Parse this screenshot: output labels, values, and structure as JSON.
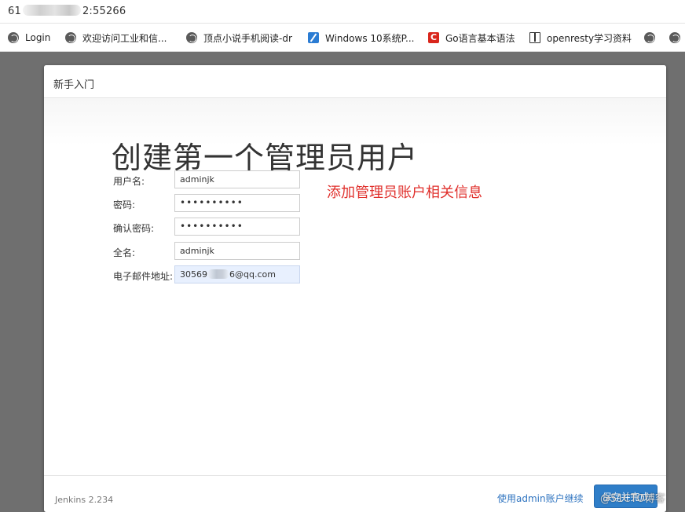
{
  "address_bar": {
    "url_prefix": "61",
    "url_suffix": "2:55266"
  },
  "bookmarks": [
    {
      "label": "Login",
      "icon": "globe-icon"
    },
    {
      "label": "欢迎访问工业和信...",
      "icon": "globe-icon"
    },
    {
      "label": "顶点小说手机阅读-dr",
      "icon": "globe-icon"
    },
    {
      "label": "Windows 10系统P...",
      "icon": "pen-icon"
    },
    {
      "label": "Go语言基本语法",
      "icon": "c-logo-icon"
    },
    {
      "label": "openresty学习资料",
      "icon": "book-icon"
    },
    {
      "label": "",
      "icon": "globe-icon"
    },
    {
      "label": "",
      "icon": "globe-icon"
    }
  ],
  "dialog": {
    "header_title": "新手入门",
    "page_title": "创建第一个管理员用户",
    "annotation": "添加管理员账户相关信息",
    "fields": [
      {
        "label": "用户名:",
        "value": "adminjk",
        "type": "text"
      },
      {
        "label": "密码:",
        "value": "••••••••••",
        "type": "password"
      },
      {
        "label": "确认密码:",
        "value": "••••••••••",
        "type": "password"
      },
      {
        "label": "全名:",
        "value": "adminjk",
        "type": "text"
      },
      {
        "label": "电子邮件地址:",
        "value_prefix": "30569",
        "value_suffix": "6@qq.com",
        "type": "email"
      }
    ],
    "footer": {
      "version": "Jenkins 2.234",
      "skip_link": "使用admin账户继续",
      "save_button": "保存并完成"
    }
  },
  "watermark": "@51CTO博客",
  "colors": {
    "annotation": "#e0302c",
    "primary_button": "#2f7ec8",
    "link": "#2f74c0"
  }
}
